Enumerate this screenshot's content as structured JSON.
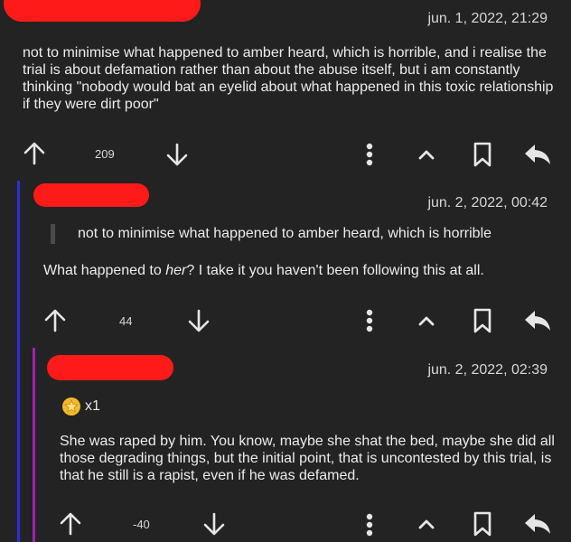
{
  "colors": {
    "background": "#232323",
    "redaction": "#ff1a1a",
    "depth1_line": "#2d2fd6",
    "depth2_line": "#a51fb4",
    "award_gold": "#f4b82a"
  },
  "comments": [
    {
      "timestamp": "jun. 1, 2022, 21:29",
      "body": "not to minimise what happened to amber heard, which is horrible, and i realise the trial is about defamation rather than about the abuse itself, but i am constantly thinking \"nobody would bat an eyelid about what happened in this toxic relationship if they were dirt poor\"",
      "score": "209"
    },
    {
      "timestamp": "jun. 2, 2022, 00:42",
      "quote": "not to minimise what happened to amber heard, which is horrible",
      "body_before": "What happened to ",
      "body_em": "her",
      "body_after": "? I take it you haven't been following this at all.",
      "score": "44"
    },
    {
      "timestamp": "jun. 2, 2022, 02:39",
      "award_icon": "award-star-icon",
      "award_count": "x1",
      "body": "She was raped by him. You know, maybe she shat the bed, maybe she did all those degrading things, but the initial point, that is uncontested by this trial, is that he still is a rapist, even if he was defamed.",
      "score": "-40"
    }
  ],
  "icons": {
    "upvote": "arrow-up-icon",
    "downvote": "arrow-down-icon",
    "more": "more-vertical-icon",
    "collapse": "chevron-up-icon",
    "save": "bookmark-icon",
    "reply": "reply-icon"
  }
}
